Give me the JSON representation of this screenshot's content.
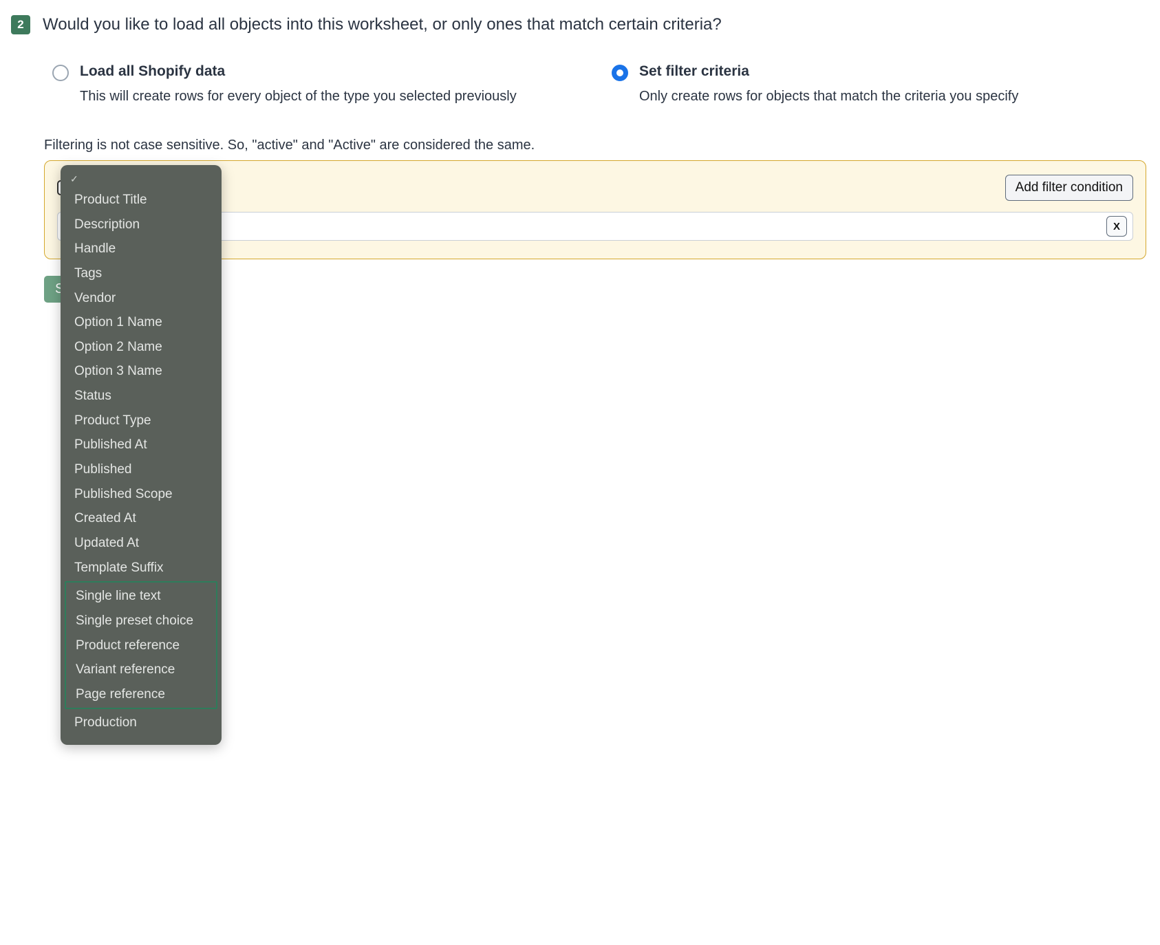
{
  "step": {
    "number": "2",
    "question": "Would you like to load all objects into this worksheet, or only ones that match certain criteria?"
  },
  "options": {
    "load_all": {
      "title": "Load all Shopify data",
      "desc": "This will create rows for every object of the type you selected previously"
    },
    "filter": {
      "title": "Set filter criteria",
      "desc": "Only create rows for objects that match the criteria you specify"
    }
  },
  "filter_note": "Filtering is not case sensitive. So, \"active\" and \"Active\" are considered the same.",
  "buttons": {
    "add_filter": "Add filter condition",
    "remove": "X",
    "save": "Sa"
  },
  "dropdown": {
    "items": [
      "Product Title",
      "Description",
      "Handle",
      "Tags",
      "Vendor",
      "Option 1 Name",
      "Option 2 Name",
      "Option 3 Name",
      "Status",
      "Product Type",
      "Published At",
      "Published",
      "Published Scope",
      "Created At",
      "Updated At",
      "Template Suffix"
    ],
    "highlighted": [
      "Single line text",
      "Single preset choice",
      "Product reference",
      "Variant reference",
      "Page reference"
    ],
    "tail": [
      "Production"
    ]
  }
}
